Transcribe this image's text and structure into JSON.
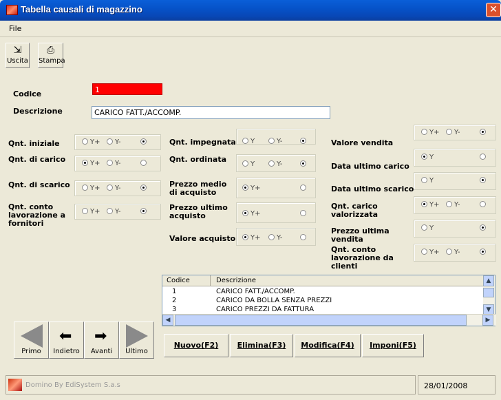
{
  "window": {
    "title": "Tabella causali di magazzino"
  },
  "menu": {
    "file": "File"
  },
  "toolbar": {
    "exit": "Uscita",
    "print": "Stampa"
  },
  "form": {
    "codice_label": "Codice",
    "codice_value": "1",
    "descrizione_label": "Descrizione",
    "descrizione_value": "CARICO FATT./ACCOMP."
  },
  "options": {
    "yplus_yminus": [
      "Y+",
      "Y-"
    ],
    "y_yminus": [
      "Y",
      "Y-"
    ],
    "y": [
      "Y"
    ],
    "yplus": [
      "Y+"
    ]
  },
  "fields": {
    "qnt_iniziale": "Qnt. iniziale",
    "qnt_di_carico": "Qnt. di carico",
    "qnt_di_scarico": "Qnt. di scarico",
    "qnt_conto_lavorazione_fornitori": "Qnt. conto lavorazione a fornitori",
    "qnt_impegnata": "Qnt. impegnata",
    "qnt_ordinata": "Qnt. ordinata",
    "prezzo_medio": "Prezzo medio di acquisto",
    "prezzo_ultimo": "Prezzo ultimo acquisto",
    "valore_acquisto": "Valore acquisto",
    "valore_vendita": "Valore vendita",
    "data_ultimo_carico": "Data ultimo carico",
    "data_ultimo_scarico": "Data ultimo scarico",
    "qnt_carico_valorizzata": "Qnt. carico valorizzata",
    "prezzo_ultima_vendita": "Prezzo ultima vendita",
    "qnt_conto_lavorazione_clienti": "Qnt. conto lavorazione da clienti"
  },
  "grid": {
    "headers": [
      "Codice",
      "Descrizione"
    ],
    "rows": [
      [
        "1",
        "CARICO FATT./ACCOMP."
      ],
      [
        "2",
        "CARICO DA BOLLA SENZA PREZZI"
      ],
      [
        "3",
        "CARICO PREZZI DA FATTURA"
      ]
    ]
  },
  "nav": {
    "first": "Primo",
    "prev": "Indietro",
    "next": "Avanti",
    "last": "Ultimo"
  },
  "actions": {
    "new": "Nuovo(F2)",
    "delete": "Elimina(F3)",
    "edit": "Modifica(F4)",
    "impose": "Imponi(F5)"
  },
  "status": {
    "company": "Domino By  EdiSystem S.a.s",
    "date": "28/01/2008"
  }
}
